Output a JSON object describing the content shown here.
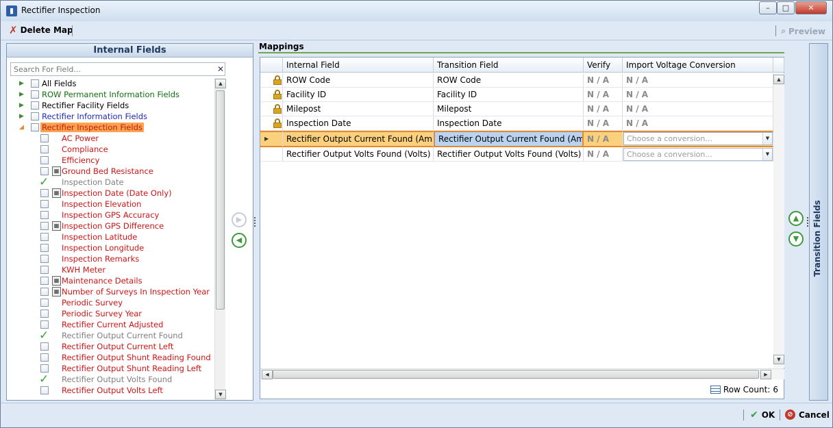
{
  "window": {
    "title": "Rectifier Inspection",
    "minimize": "–",
    "maximize": "□",
    "close": "✕"
  },
  "toolbar": {
    "delete_map": "Delete Map",
    "preview": "Preview"
  },
  "internal_fields": {
    "header": "Internal Fields",
    "search_placeholder": "Search For Field...",
    "clear": "✕",
    "groups": [
      {
        "label": "All Fields",
        "color": "black"
      },
      {
        "label": "ROW Permanent Information Fields",
        "color": "green"
      },
      {
        "label": "Rectifier Facility Fields",
        "color": "black"
      },
      {
        "label": "Rectifier Information Fields",
        "color": "blue"
      },
      {
        "label": "Rectifier Inspection Fields",
        "color": "red",
        "expanded": true,
        "selected": true
      }
    ],
    "items": [
      {
        "label": "AC Power",
        "state": "unchecked"
      },
      {
        "label": "Compliance",
        "state": "unchecked"
      },
      {
        "label": "Efficiency",
        "state": "unchecked"
      },
      {
        "label": "Ground Bed Resistance",
        "state": "unchecked",
        "calc": true
      },
      {
        "label": "Inspection Date",
        "state": "mapped"
      },
      {
        "label": "Inspection Date (Date Only)",
        "state": "unchecked",
        "calc": true
      },
      {
        "label": "Inspection Elevation",
        "state": "unchecked"
      },
      {
        "label": "Inspection GPS Accuracy",
        "state": "unchecked"
      },
      {
        "label": "Inspection GPS Difference",
        "state": "unchecked",
        "calc": true
      },
      {
        "label": "Inspection Latitude",
        "state": "unchecked"
      },
      {
        "label": "Inspection Longitude",
        "state": "unchecked"
      },
      {
        "label": "Inspection Remarks",
        "state": "unchecked"
      },
      {
        "label": "KWH Meter",
        "state": "unchecked"
      },
      {
        "label": "Maintenance Details",
        "state": "unchecked",
        "calc": true
      },
      {
        "label": "Number of Surveys In Inspection Year",
        "state": "unchecked",
        "calc": true
      },
      {
        "label": "Periodic Survey",
        "state": "unchecked"
      },
      {
        "label": "Periodic Survey Year",
        "state": "unchecked"
      },
      {
        "label": "Rectifier Current Adjusted",
        "state": "unchecked"
      },
      {
        "label": "Rectifier Output Current Found",
        "state": "mapped"
      },
      {
        "label": "Rectifier Output Current Left",
        "state": "unchecked"
      },
      {
        "label": "Rectifier Output Shunt Reading Found",
        "state": "unchecked"
      },
      {
        "label": "Rectifier Output Shunt Reading Left",
        "state": "unchecked"
      },
      {
        "label": "Rectifier Output Volts Found",
        "state": "mapped"
      },
      {
        "label": "Rectifier Output Volts Left",
        "state": "unchecked"
      }
    ]
  },
  "mappings": {
    "header": "Mappings",
    "columns": [
      "Internal Field",
      "Transition Field",
      "Verify",
      "Import Voltage Conversion"
    ],
    "rows": [
      {
        "internal": "ROW Code",
        "transition": "ROW Code",
        "verify": "N / A",
        "conversion": "N / A",
        "locked": true
      },
      {
        "internal": "Facility ID",
        "transition": "Facility ID",
        "verify": "N / A",
        "conversion": "N / A",
        "locked": true
      },
      {
        "internal": "Milepost",
        "transition": "Milepost",
        "verify": "N / A",
        "conversion": "N / A",
        "locked": true
      },
      {
        "internal": "Inspection Date",
        "transition": "Inspection Date",
        "verify": "N / A",
        "conversion": "N / A",
        "locked": true
      },
      {
        "internal": "Rectifier Output Current Found (Amps)",
        "transition": "Rectifier Output Current Found (Amps)",
        "verify": "N / A",
        "conversion_placeholder": "Choose a conversion...",
        "selected": true
      },
      {
        "internal": "Rectifier Output Volts Found (Volts)",
        "transition": "Rectifier Output Volts Found (Volts)",
        "verify": "N / A",
        "conversion_placeholder": "Choose a conversion..."
      }
    ],
    "row_count_label": "Row Count:",
    "row_count": "6"
  },
  "transition_fields": {
    "label": "Transition Fields"
  },
  "footer": {
    "ok": "OK",
    "cancel": "Cancel"
  },
  "colors": {
    "accent_green": "#3b9a3b",
    "selected_row": "#fbd17e",
    "selection_border": "#e6892a",
    "panel_header": "#203a60"
  }
}
